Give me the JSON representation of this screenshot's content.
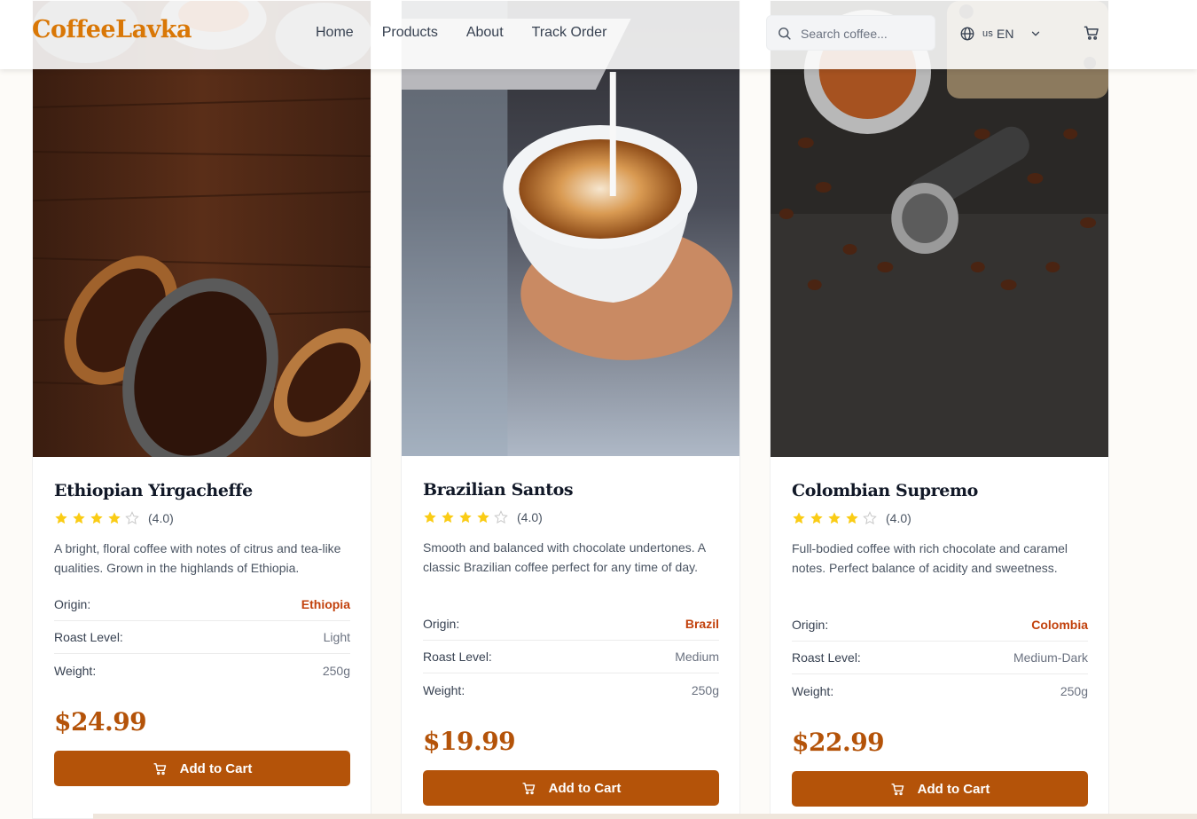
{
  "header": {
    "logo": "CoffeeLavka",
    "nav": [
      "Home",
      "Products",
      "About",
      "Track Order"
    ],
    "search_placeholder": "Search coffee...",
    "language": {
      "flag": "us",
      "code": "EN"
    }
  },
  "icons": {
    "search": "search-icon",
    "globe": "globe-icon",
    "chevron": "chevron-down-icon",
    "cart": "shopping-cart-icon",
    "star": "star-icon"
  },
  "colors": {
    "brand": "#d97706",
    "accent": "#b45309",
    "origin_text": "#c2410c",
    "star": "#facc15"
  },
  "products": [
    {
      "name": "Ethiopian Yirgacheffe",
      "rating": 4,
      "rating_text": "(4.0)",
      "description": "A bright, floral coffee with notes of citrus and tea-like qualities. Grown in the highlands of Ethiopia.",
      "origin_label": "Origin:",
      "origin": "Ethiopia",
      "roast_label": "Roast Level:",
      "roast": "Light",
      "weight_label": "Weight:",
      "weight": "250g",
      "price": "$24.99",
      "button": "Add to Cart"
    },
    {
      "name": "Brazilian Santos",
      "rating": 4,
      "rating_text": "(4.0)",
      "description": "Smooth and balanced with chocolate undertones. A classic Brazilian coffee perfect for any time of day.",
      "origin_label": "Origin:",
      "origin": "Brazil",
      "roast_label": "Roast Level:",
      "roast": "Medium",
      "weight_label": "Weight:",
      "weight": "250g",
      "price": "$19.99",
      "button": "Add to Cart"
    },
    {
      "name": "Colombian Supremo",
      "rating": 4,
      "rating_text": "(4.0)",
      "description": "Full-bodied coffee with rich chocolate and caramel notes. Perfect balance of acidity and sweetness.",
      "origin_label": "Origin:",
      "origin": "Colombia",
      "roast_label": "Roast Level:",
      "roast": "Medium-Dark",
      "weight_label": "Weight:",
      "weight": "250g",
      "price": "$22.99",
      "button": "Add to Cart"
    }
  ]
}
